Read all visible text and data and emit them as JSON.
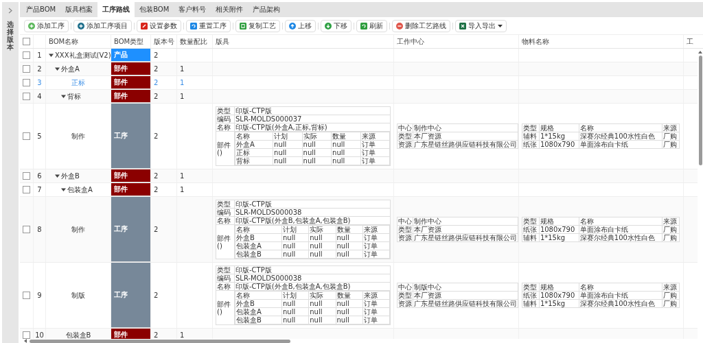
{
  "sidebar": {
    "title": "选择版本",
    "collapsed": true
  },
  "tabs": [
    {
      "label": "产品BOM",
      "selected": false
    },
    {
      "label": "版具档案",
      "selected": false
    },
    {
      "label": "工序路线",
      "selected": true
    },
    {
      "label": "包装BOM",
      "selected": false
    },
    {
      "label": "客户料号",
      "selected": false
    },
    {
      "label": "相关附件",
      "selected": false
    },
    {
      "label": "产品架构",
      "selected": false
    }
  ],
  "toolbar": [
    {
      "label": "添加工序",
      "kind": "add"
    },
    {
      "label": "添加工序项目",
      "kind": "add-item"
    },
    {
      "label": "设置参数",
      "kind": "edit"
    },
    {
      "label": "重置工序",
      "kind": "reset"
    },
    {
      "label": "复制工艺",
      "kind": "copy"
    },
    {
      "label": "上移",
      "kind": "up"
    },
    {
      "label": "下移",
      "kind": "down"
    },
    {
      "label": "刷新",
      "kind": "refresh"
    },
    {
      "label": "删除工艺路线",
      "kind": "delete"
    },
    {
      "label": "导入导出",
      "kind": "excel"
    }
  ],
  "table": {
    "select_all": {
      "checked": false
    },
    "columns": [
      "BOM名称",
      "BOM类型",
      "版本号",
      "数量配比",
      "版具",
      "工作中心",
      "物料名称",
      "工"
    ],
    "rows": [
      {
        "no": "1",
        "name": "XXX礼盒测试(V2)",
        "type": {
          "label": "产品",
          "color": "#1e90ff"
        },
        "version": "2",
        "checked": false,
        "selected": false,
        "expanded": true,
        "children": [
          {
            "no": "2",
            "name": "外盒A",
            "type": {
              "label": "部件",
              "color": "#8b0000"
            },
            "version": "2",
            "ratio": "1",
            "checked": false,
            "selected": false,
            "expanded": true,
            "children": [
              {
                "no": "3",
                "name": "正标",
                "type": {
                  "label": "部件",
                  "color": "#8b0000"
                },
                "version": "2",
                "ratio": "1",
                "checked": false,
                "selected": true
              },
              {
                "no": "4",
                "name": "背标",
                "type": {
                  "label": "部件",
                  "color": "#8b0000"
                },
                "version": "2",
                "ratio": "1",
                "checked": false,
                "selected": false,
                "expanded": true,
                "children": [
                  {
                    "no": "5",
                    "name": "制作",
                    "type": {
                      "label": "工序",
                      "color": "#778899"
                    },
                    "version": "2",
                    "checked": false,
                    "selected": false,
                    "process": {
                      "mold": {
                        "fields": [
                          {
                            "label": "类型",
                            "value": "印版-CTP版"
                          },
                          {
                            "label": "编码",
                            "value": "SLR-MOLDS000037"
                          },
                          {
                            "label": "名称",
                            "value": "印版-CTP版(外盒A,正标,背标)"
                          }
                        ],
                        "parts_label": [
                          "部件",
                          "()"
                        ],
                        "parts_columns": [
                          "名称",
                          "计划",
                          "实际",
                          "数量",
                          "来源"
                        ],
                        "parts": [
                          [
                            "外盒A",
                            "null",
                            "null",
                            "null",
                            "订单"
                          ],
                          [
                            "正标",
                            "null",
                            "null",
                            "null",
                            "订单"
                          ],
                          [
                            "背标",
                            "null",
                            "null",
                            "null",
                            "订单"
                          ]
                        ]
                      },
                      "work_center": [
                        {
                          "label": "中心",
                          "value": "制作中心"
                        },
                        {
                          "label": "类型",
                          "value": "本厂资源"
                        },
                        {
                          "label": "资源",
                          "value": "广东星链丝路供应链科技有限公司"
                        }
                      ],
                      "materials": {
                        "columns": [
                          "类型",
                          "规格",
                          "名称",
                          "来源"
                        ],
                        "rows": [
                          [
                            "辅料",
                            "1*15kg",
                            "深赛尔经典100水性白色",
                            "厂购"
                          ],
                          [
                            "纸张",
                            "1080x790",
                            "单面涂布白卡纸",
                            "厂购"
                          ]
                        ]
                      }
                    }
                  }
                ]
              }
            ]
          },
          {
            "no": "6",
            "name": "外盒B",
            "type": {
              "label": "部件",
              "color": "#8b0000"
            },
            "version": "2",
            "ratio": "1",
            "checked": false,
            "selected": false,
            "expanded": true,
            "children": [
              {
                "no": "7",
                "name": "包装盒A",
                "type": {
                  "label": "部件",
                  "color": "#8b0000"
                },
                "version": "2",
                "ratio": "1",
                "checked": false,
                "selected": false,
                "expanded": true,
                "children": [
                  {
                    "no": "8",
                    "name": "制作",
                    "type": {
                      "label": "工序",
                      "color": "#778899"
                    },
                    "version": "2",
                    "checked": false,
                    "selected": false,
                    "process": {
                      "mold": {
                        "fields": [
                          {
                            "label": "类型",
                            "value": "印版-CTP版"
                          },
                          {
                            "label": "编码",
                            "value": "SLR-MOLDS000038"
                          },
                          {
                            "label": "名称",
                            "value": "印版-CTP版(外盒B,包装盒A,包装盒B)"
                          }
                        ],
                        "parts_label": [
                          "部件",
                          "()"
                        ],
                        "parts_columns": [
                          "名称",
                          "计划",
                          "实际",
                          "数量",
                          "来源"
                        ],
                        "parts": [
                          [
                            "外盒B",
                            "null",
                            "null",
                            "null",
                            "订单"
                          ],
                          [
                            "包装盒A",
                            "null",
                            "null",
                            "null",
                            "订单"
                          ],
                          [
                            "包装盒B",
                            "null",
                            "null",
                            "null",
                            "订单"
                          ]
                        ]
                      },
                      "work_center": [
                        {
                          "label": "中心",
                          "value": "制作中心"
                        },
                        {
                          "label": "类型",
                          "value": "本厂资源"
                        },
                        {
                          "label": "资源",
                          "value": "广东星链丝路供应链科技有限公司"
                        }
                      ],
                      "materials": {
                        "columns": [
                          "类型",
                          "规格",
                          "名称",
                          "来源"
                        ],
                        "rows": [
                          [
                            "纸张",
                            "1080x790",
                            "单面涂布白卡纸",
                            "厂购"
                          ],
                          [
                            "辅料",
                            "1*15kg",
                            "深赛尔经典100水性白色",
                            "厂购"
                          ]
                        ]
                      }
                    }
                  },
                  {
                    "no": "9",
                    "name": "制版",
                    "type": {
                      "label": "工序",
                      "color": "#778899"
                    },
                    "version": "2",
                    "checked": false,
                    "selected": false,
                    "process": {
                      "mold": {
                        "fields": [
                          {
                            "label": "类型",
                            "value": "印版-CTP版"
                          },
                          {
                            "label": "编码",
                            "value": "SLR-MOLDS000038"
                          },
                          {
                            "label": "名称",
                            "value": "印版-CTP版(外盒B,包装盒A,包装盒B)"
                          }
                        ],
                        "parts_label": [
                          "部件",
                          "()"
                        ],
                        "parts_columns": [
                          "名称",
                          "计划",
                          "实际",
                          "数量",
                          "来源"
                        ],
                        "parts": [
                          [
                            "外盒B",
                            "null",
                            "null",
                            "null",
                            "订单"
                          ],
                          [
                            "包装盒A",
                            "null",
                            "null",
                            "null",
                            "订单"
                          ],
                          [
                            "包装盒B",
                            "null",
                            "null",
                            "null",
                            "订单"
                          ]
                        ]
                      },
                      "work_center": [
                        {
                          "label": "中心",
                          "value": "制版中心"
                        },
                        {
                          "label": "类型",
                          "value": "本厂资源"
                        },
                        {
                          "label": "资源",
                          "value": "广东星链丝路供应链科技有限公司"
                        }
                      ],
                      "materials": {
                        "columns": [
                          "类型",
                          "规格",
                          "名称",
                          "来源"
                        ],
                        "rows": [
                          [
                            "纸张",
                            "1080x790",
                            "单面涂布白卡纸",
                            "厂购"
                          ],
                          [
                            "辅料",
                            "1*15kg",
                            "深赛尔经典100水性白色",
                            "厂购"
                          ]
                        ]
                      }
                    }
                  }
                ]
              },
              {
                "no": "10",
                "name": "包装盒B",
                "type": {
                  "label": "部件",
                  "color": "#8b0000"
                },
                "version": "2",
                "ratio": "1",
                "checked": false,
                "selected": false
              }
            ]
          }
        ]
      }
    ]
  }
}
